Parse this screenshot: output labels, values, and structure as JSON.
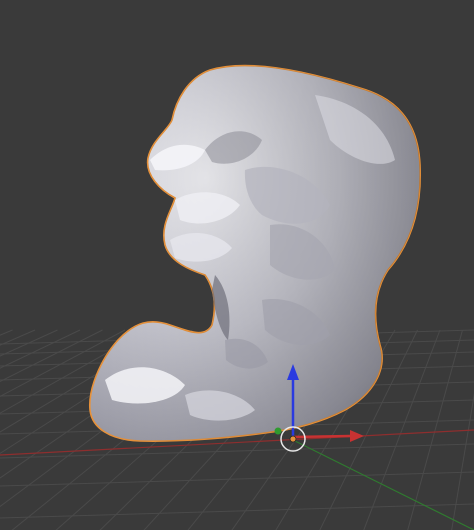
{
  "app": {
    "name": "3D viewport"
  },
  "viewport": {
    "background_color": "#3a3a3a",
    "grid_color": "#4a4a4a",
    "mesh_color": "#c8c8d2",
    "selection_outline_color": "#e8923a",
    "x_axis_color": "#c83232",
    "y_axis_color": "#2f9a2f",
    "z_axis_color": "#2a3ae0",
    "object": {
      "icon": "sculpted-mesh",
      "selected": true
    },
    "gizmo": {
      "icon": "translate-gizmo",
      "axes": [
        "x",
        "z"
      ]
    },
    "cursor_3d": {
      "icon": "3d-cursor"
    }
  }
}
